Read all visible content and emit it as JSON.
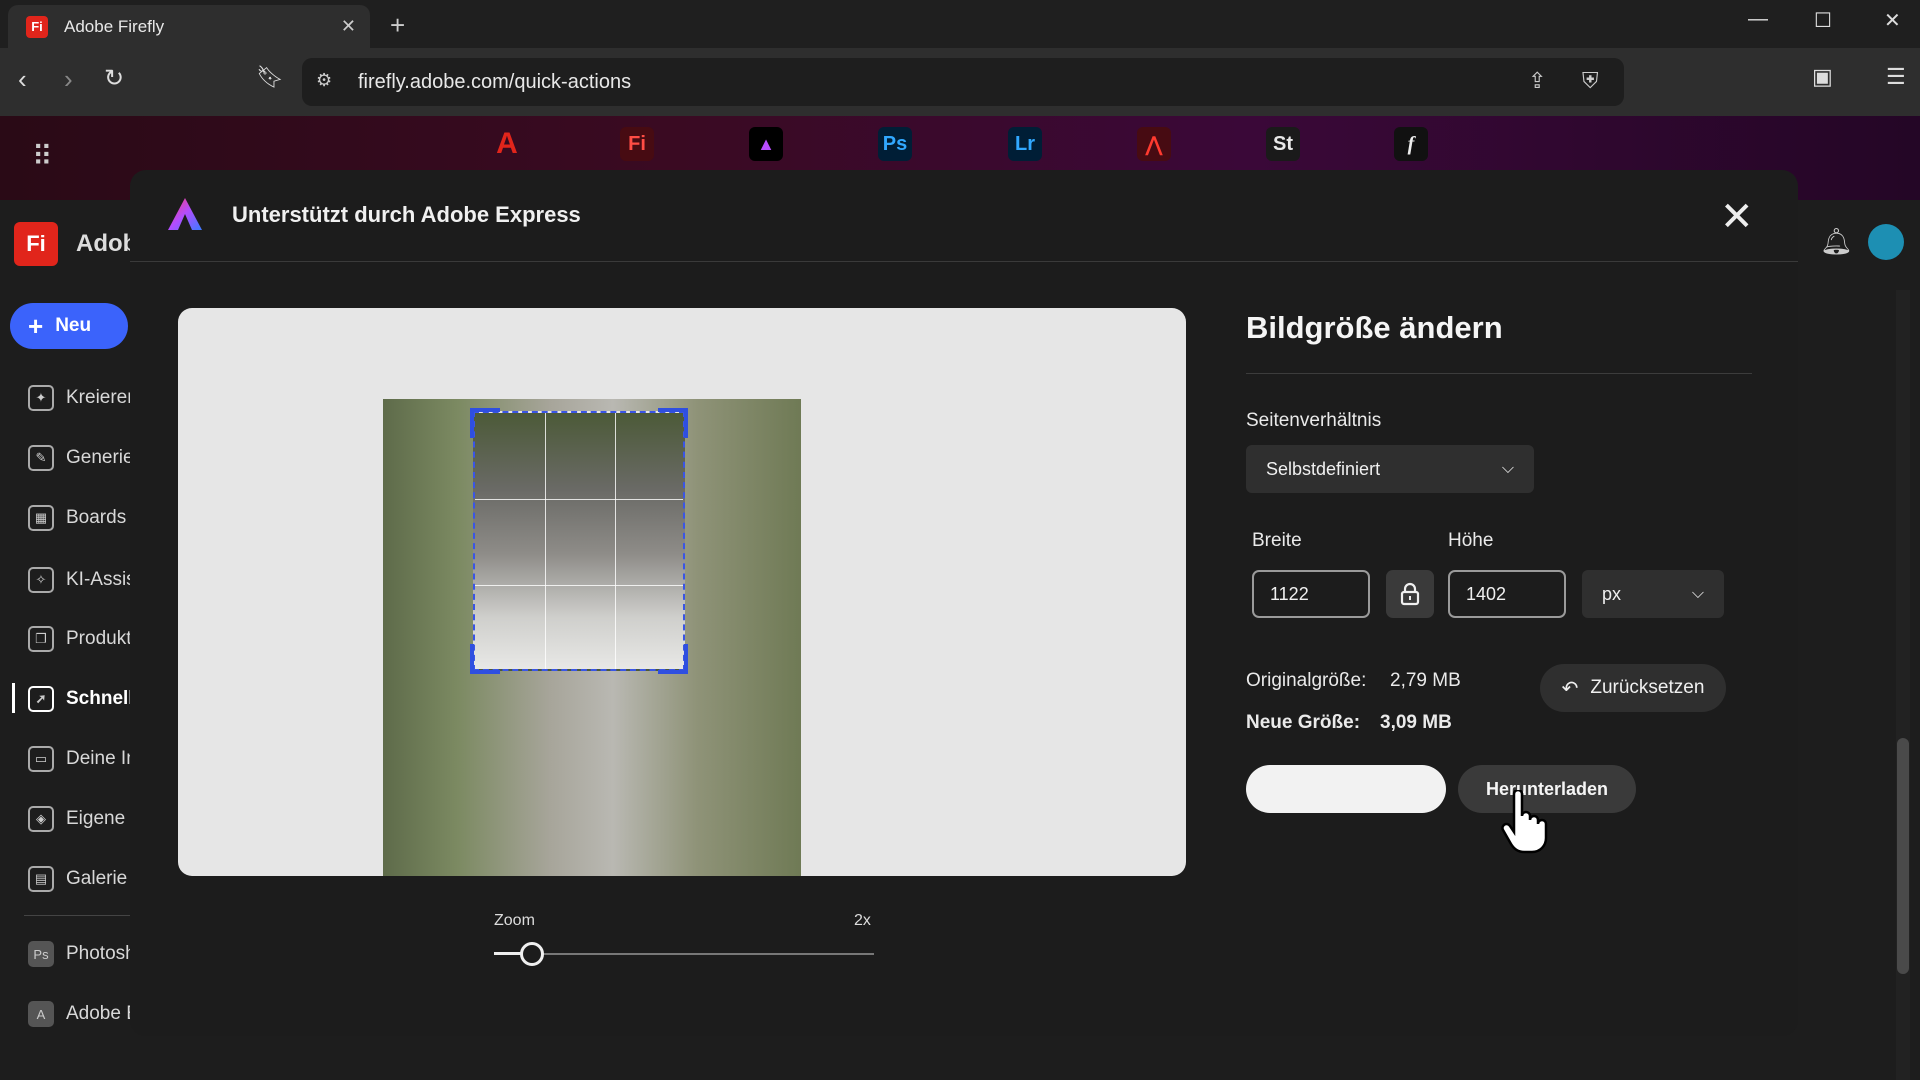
{
  "browser": {
    "tab_title": "Adobe Firefly",
    "tab_badge": "Fi",
    "url": "firefly.adobe.com/quick-actions"
  },
  "appbar": {
    "apps": [
      {
        "label": "A",
        "name": "adobe"
      },
      {
        "label": "Fi",
        "name": "firefly"
      },
      {
        "label": "▲",
        "name": "express"
      },
      {
        "label": "Ps",
        "name": "photoshop"
      },
      {
        "label": "Lr",
        "name": "lightroom"
      },
      {
        "label": "⋀",
        "name": "acrobat"
      },
      {
        "label": "St",
        "name": "stock"
      },
      {
        "label": "f",
        "name": "fonts"
      }
    ]
  },
  "sidebar": {
    "brand": "Adob",
    "new_label": "Neu",
    "items": [
      {
        "label": "Kreieren"
      },
      {
        "label": "Generie"
      },
      {
        "label": "Boards"
      },
      {
        "label": "KI-Assis"
      },
      {
        "label": "Produkt"
      },
      {
        "label": "Schnell"
      },
      {
        "label": "Deine In"
      },
      {
        "label": "Eigene I"
      },
      {
        "label": "Galerie"
      },
      {
        "label": "Photosh"
      },
      {
        "label": "Adobe E"
      }
    ]
  },
  "modal": {
    "title": "Unterstützt durch Adobe Express",
    "zoom_label": "Zoom",
    "zoom_value": "2x",
    "zoom_level": 0.1,
    "panel_title": "Bildgröße ändern",
    "aspect_label": "Seitenverhältnis",
    "aspect_value": "Selbstdefiniert",
    "width_label": "Breite",
    "width_value": "1122",
    "height_label": "Höhe",
    "height_value": "1402",
    "unit_value": "px",
    "original_label": "Originalgröße:",
    "original_value": "2,79 MB",
    "new_label": "Neue Größe:",
    "new_value": "3,09 MB",
    "reset_label": "Zurücksetzen",
    "download_label": "Herunterladen"
  }
}
